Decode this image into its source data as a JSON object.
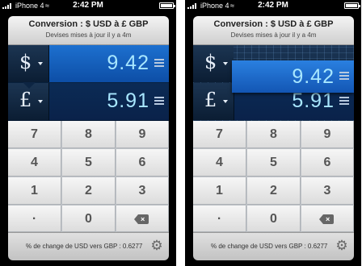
{
  "screens": [
    {
      "status": {
        "carrier": "iPhone 4",
        "time": "2:42 PM"
      },
      "header": {
        "title": "Conversion : $ USD à £ GBP",
        "subtitle": "Devises mises à jour il y a 4m"
      },
      "rows": [
        {
          "currency_symbol": "$",
          "value": "9.42"
        },
        {
          "currency_symbol": "£",
          "value": "5.91"
        }
      ],
      "keypad": {
        "keys": [
          "7",
          "8",
          "9",
          "4",
          "5",
          "6",
          "1",
          "2",
          "3",
          "·",
          "0"
        ],
        "delete_icon": "backspace-icon"
      },
      "footer": {
        "rate_text": "% de change de USD vers GBP : 0.6277",
        "settings_icon": "gear-icon"
      }
    },
    {
      "status": {
        "carrier": "iPhone 4",
        "time": "2:42 PM"
      },
      "header": {
        "title": "Conversion : $ USD à £ GBP",
        "subtitle": "Devises mises à jour il y a 4m"
      },
      "rows": [
        {
          "currency_symbol": "$",
          "value": "9.42"
        },
        {
          "currency_symbol": "£",
          "value": "5.91"
        }
      ],
      "keypad": {
        "keys": [
          "7",
          "8",
          "9",
          "4",
          "5",
          "6",
          "1",
          "2",
          "3",
          "·",
          "0"
        ],
        "delete_icon": "backspace-icon"
      },
      "footer": {
        "rate_text": "% de change de USD vers GBP : 0.6277",
        "settings_icon": "gear-icon"
      }
    }
  ],
  "colors": {
    "accent_blue": "#1d70cf",
    "digit_color": "#a8e7ff",
    "panel_dark": "#0a2544"
  }
}
